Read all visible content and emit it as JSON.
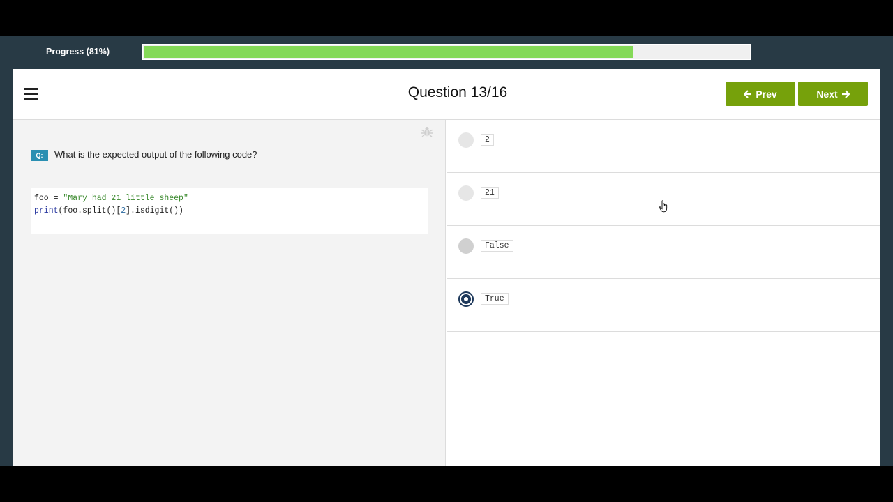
{
  "progress": {
    "label": "Progress (81%)",
    "fraction": 0.81
  },
  "header": {
    "title": "Question 13/16",
    "prev_label": "Prev",
    "next_label": "Next"
  },
  "question": {
    "badge": "Q:",
    "text": "What is the expected output of the following code?",
    "code": [
      {
        "parts": [
          {
            "t": "foo = ",
            "c": ""
          },
          {
            "t": "\"Mary had 21 little sheep\"",
            "c": "str"
          }
        ]
      },
      {
        "parts": [
          {
            "t": "print",
            "c": "kw"
          },
          {
            "t": "(foo.split()[",
            "c": ""
          },
          {
            "t": "2",
            "c": "num"
          },
          {
            "t": "].isdigit())",
            "c": ""
          }
        ]
      }
    ]
  },
  "options": [
    {
      "label": "2",
      "state": "default"
    },
    {
      "label": "21",
      "state": "default"
    },
    {
      "label": "False",
      "state": "hover"
    },
    {
      "label": "True",
      "state": "selected"
    }
  ],
  "colors": {
    "accent_green": "#76a10b",
    "progress_fill": "#84d957",
    "badge_blue": "#2a8fb2",
    "selected_radio": "#1f3a5c"
  },
  "icons": {
    "menu": "hamburger-icon",
    "report": "bug-icon",
    "prev": "arrow-left-icon",
    "next": "arrow-right-icon"
  }
}
